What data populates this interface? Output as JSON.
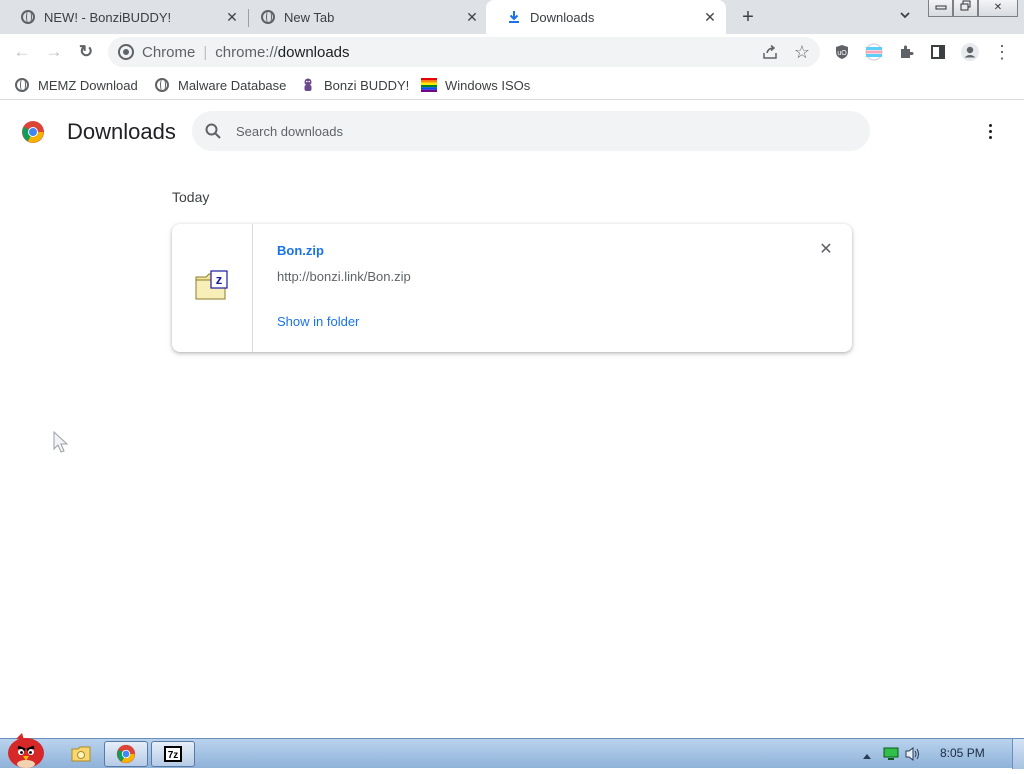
{
  "tabs": [
    {
      "title": "NEW! - BonziBUDDY!",
      "active": false
    },
    {
      "title": "New Tab",
      "active": false
    },
    {
      "title": "Downloads",
      "active": true
    }
  ],
  "tab_close_glyph": "✕",
  "new_tab_glyph": "+",
  "tab_search_glyph": "⌄",
  "window_controls": {
    "minimize": "▭",
    "restore": "❐",
    "close": "✕"
  },
  "toolbar": {
    "back_glyph": "←",
    "forward_glyph": "→",
    "reload_glyph": "↻",
    "scheme_label": "Chrome",
    "url_prefix": "chrome://",
    "url_path": "downloads",
    "share_glyph": "⇪",
    "star_glyph": "☆",
    "menu_glyph": "⋮"
  },
  "bookmarks": [
    {
      "label": "MEMZ Download",
      "icon": "globe-icon"
    },
    {
      "label": "Malware Database",
      "icon": "globe-icon"
    },
    {
      "label": "Bonzi BUDDY!",
      "icon": "bonzi-icon"
    },
    {
      "label": "Windows ISOs",
      "icon": "rainbow-flag-icon"
    }
  ],
  "page": {
    "title": "Downloads",
    "search_placeholder": "Search downloads",
    "date_header": "Today"
  },
  "download": {
    "file_name": "Bon.zip",
    "url": "http://bonzi.link/Bon.zip",
    "action_label": "Show in folder",
    "remove_glyph": "✕"
  },
  "taskbar": {
    "clock": "8:05 PM"
  },
  "colors": {
    "accent": "#1a73e8",
    "tabstrip": "#dee1e6",
    "omnibox": "#f1f3f4"
  }
}
